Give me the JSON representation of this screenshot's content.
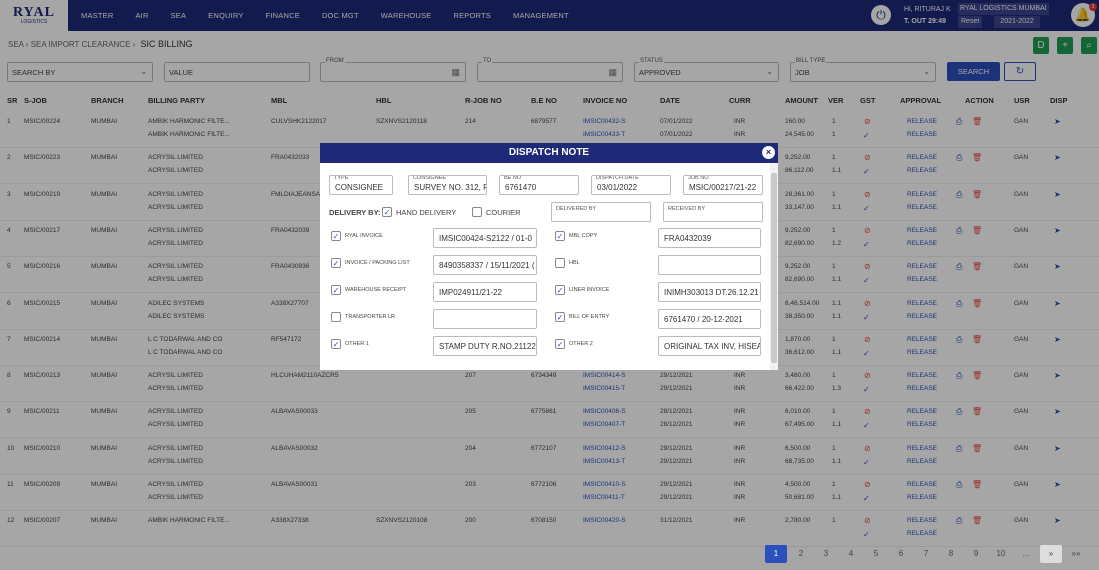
{
  "app": {
    "logo": "RYAL",
    "logo_sub": "LOGISTICS",
    "menu": [
      "MASTER",
      "AIR",
      "SEA",
      "ENQUIRY",
      "FINANCE",
      "DOC MGT",
      "WAREHOUSE",
      "REPORTS",
      "MANAGEMENT"
    ],
    "user_greeting": "Hi, RITURAJ K",
    "user_time": "T. OUT 29:49",
    "company": "RYAL LOGISTICS MUMBAI",
    "reset": "Reset",
    "year": "2021-2022",
    "notif_count": "3"
  },
  "breadcrumb": {
    "a": "SEA",
    "b": "SEA IMPORT CLEARANCE",
    "current": "SIC BILLING"
  },
  "actions": {
    "d": "D",
    "plus": "+",
    "search": "⌕"
  },
  "filters": {
    "search_by": "SEARCH BY",
    "value": "VALUE",
    "from_label": "FROM",
    "to_label": "TO",
    "status_label": "STATUS",
    "status_value": "APPROVED",
    "billtype_label": "BILL TYPE",
    "billtype_value": "JOB",
    "search_btn": "SEARCH",
    "refresh": "↻"
  },
  "table": {
    "headers": [
      "SR",
      "S-JOB",
      "BRANCH",
      "BILLING PARTY",
      "MBL",
      "HBL",
      "R-JOB NO",
      "B.E NO",
      "INVOICE NO",
      "DATE",
      "CURR",
      "AMOUNT",
      "VER",
      "GST",
      "APPROVAL",
      "ACTION",
      "USR",
      "DISP"
    ],
    "rows": [
      {
        "sr": "1",
        "job": "MSIC/00224",
        "branch": "MUMBAI",
        "party1": "AMBIK HARMONIC FILTE...",
        "party2": "AMBIK HARMONIC FILTE...",
        "mbl": "CULVSHK2122017",
        "hbl": "SZXNVS2120118",
        "rjob": "214",
        "be": "6879577",
        "inv1": "IMSIC00432-S",
        "inv2": "IMSIC00433-T",
        "d1": "07/01/2022",
        "d2": "07/01/2022",
        "c1": "INR",
        "c2": "INR",
        "a1": "260.00",
        "a2": "24,545.00",
        "v1": "1",
        "v2": "1",
        "app": "RELEASE",
        "usr": "GAN"
      },
      {
        "sr": "2",
        "job": "MSIC/00223",
        "branch": "MUMBAI",
        "party1": "ACRYSIL LIMITED",
        "party2": "ACRYSIL LIMITED",
        "mbl": "FRA0432033",
        "hbl": "",
        "rjob": "",
        "be": "",
        "inv1": "",
        "inv2": "",
        "d1": "",
        "d2": "",
        "c1": "",
        "c2": "",
        "a1": "9,252.00",
        "a2": "86,112.00",
        "v1": "1",
        "v2": "1.1",
        "app": "RELEASE",
        "usr": "GAN"
      },
      {
        "sr": "3",
        "job": "MSIC/00219",
        "branch": "MUMBAI",
        "party1": "ACRYSIL LIMITED",
        "party2": "ACRYSIL LIMITED",
        "mbl": "FMLDIAJEANSA0",
        "hbl": "",
        "rjob": "",
        "be": "",
        "inv1": "",
        "inv2": "",
        "d1": "",
        "d2": "",
        "c1": "",
        "c2": "",
        "a1": "28,361.00",
        "a2": "33,147.00",
        "v1": "1",
        "v2": "1.1",
        "app": "RELEASE",
        "usr": "GAN"
      },
      {
        "sr": "4",
        "job": "MSIC/00217",
        "branch": "MUMBAI",
        "party1": "ACRYSIL LIMITED",
        "party2": "ACRYSIL LIMITED",
        "mbl": "FRA0432039",
        "hbl": "",
        "rjob": "",
        "be": "",
        "inv1": "",
        "inv2": "",
        "d1": "",
        "d2": "",
        "c1": "",
        "c2": "",
        "a1": "9,252.00",
        "a2": "82,690.00",
        "v1": "1",
        "v2": "1.2",
        "app": "RELEASE",
        "usr": "GAN"
      },
      {
        "sr": "5",
        "job": "MSIC/00216",
        "branch": "MUMBAI",
        "party1": "ACRYSIL LIMITED",
        "party2": "ACRYSIL LIMITED",
        "mbl": "FRA0430936",
        "hbl": "",
        "rjob": "",
        "be": "",
        "inv1": "",
        "inv2": "",
        "d1": "",
        "d2": "",
        "c1": "",
        "c2": "",
        "a1": "9,252.00",
        "a2": "82,690.00",
        "v1": "1",
        "v2": "1.1",
        "app": "RELEASE",
        "usr": "GAN"
      },
      {
        "sr": "6",
        "job": "MSIC/00215",
        "branch": "MUMBAI",
        "party1": "ADILEC SYSTEMS",
        "party2": "ADILEC SYSTEMS",
        "mbl": "A338X27707",
        "hbl": "",
        "rjob": "",
        "be": "",
        "inv1": "",
        "inv2": "",
        "d1": "",
        "d2": "",
        "c1": "",
        "c2": "",
        "a1": "6,46,514.00",
        "a2": "38,350.00",
        "v1": "1.1",
        "v2": "1.1",
        "app": "RELEASE",
        "usr": "GAN"
      },
      {
        "sr": "7",
        "job": "MSIC/00214",
        "branch": "MUMBAI",
        "party1": "L C TODARWAL AND CO",
        "party2": "L C TODARWAL AND CO",
        "mbl": "RF547172",
        "hbl": "",
        "rjob": "",
        "be": "",
        "inv1": "",
        "inv2": "",
        "d1": "",
        "d2": "",
        "c1": "",
        "c2": "",
        "a1": "1,870.00",
        "a2": "36,612.00",
        "v1": "1",
        "v2": "1.1",
        "app": "RELEASE",
        "usr": "GAN"
      },
      {
        "sr": "8",
        "job": "MSIC/00213",
        "branch": "MUMBAI",
        "party1": "ACRYSIL LIMITED",
        "party2": "ACRYSIL LIMITED",
        "mbl": "HLCUHAM2110AZCR5",
        "hbl": "",
        "rjob": "207",
        "be": "6734349",
        "inv1": "IMSIC00414-S",
        "inv2": "IMSIC00415-T",
        "d1": "29/12/2021",
        "d2": "29/12/2021",
        "c1": "INR",
        "c2": "INR",
        "a1": "3,480.00",
        "a2": "66,422.00",
        "v1": "1",
        "v2": "1.3",
        "app": "RELEASE",
        "usr": "GAN"
      },
      {
        "sr": "9",
        "job": "MSIC/00211",
        "branch": "MUMBAI",
        "party1": "ACRYSIL LIMITED",
        "party2": "ACRYSIL LIMITED",
        "mbl": "ALBAVAS00033",
        "hbl": "",
        "rjob": "205",
        "be": "6775861",
        "inv1": "IMSIC00406-S",
        "inv2": "IMSIC00407-T",
        "d1": "28/12/2021",
        "d2": "28/12/2021",
        "c1": "INR",
        "c2": "INR",
        "a1": "6,010.00",
        "a2": "67,495.00",
        "v1": "1",
        "v2": "1.1",
        "app": "RELEASE",
        "usr": "GAN"
      },
      {
        "sr": "10",
        "job": "MSIC/00210",
        "branch": "MUMBAI",
        "party1": "ACRYSIL LIMITED",
        "party2": "ACRYSIL LIMITED",
        "mbl": "ALBAVAS00032",
        "hbl": "",
        "rjob": "204",
        "be": "6772107",
        "inv1": "IMSIC00412-S",
        "inv2": "IMSIC00413-T",
        "d1": "29/12/2021",
        "d2": "29/12/2021",
        "c1": "INR",
        "c2": "INR",
        "a1": "6,500.00",
        "a2": "68,735.00",
        "v1": "1",
        "v2": "1.1",
        "app": "RELEASE",
        "usr": "GAN"
      },
      {
        "sr": "11",
        "job": "MSIC/00209",
        "branch": "MUMBAI",
        "party1": "ACRYSIL LIMITED",
        "party2": "ACRYSIL LIMITED",
        "mbl": "ALBAVAS00031",
        "hbl": "",
        "rjob": "203",
        "be": "6772106",
        "inv1": "IMSIC00410-S",
        "inv2": "IMSIC00411-T",
        "d1": "29/12/2021",
        "d2": "29/12/2021",
        "c1": "INR",
        "c2": "INR",
        "a1": "4,500.00",
        "a2": "50,681.00",
        "v1": "1",
        "v2": "1.1",
        "app": "RELEASE",
        "usr": "GAN"
      },
      {
        "sr": "12",
        "job": "MSIC/00207",
        "branch": "MUMBAI",
        "party1": "AMBIK HARMONIC FILTE...",
        "party2": "",
        "mbl": "A338X27338",
        "hbl": "SZXNVS2120108",
        "rjob": "200",
        "be": "6708150",
        "inv1": "IMSIC00420-S",
        "inv2": "",
        "d1": "31/12/2021",
        "d2": "",
        "c1": "INR",
        "c2": "",
        "a1": "2,780.00",
        "a2": "",
        "v1": "1",
        "v2": "",
        "app": "RELEASE",
        "usr": "GAN"
      }
    ]
  },
  "modal": {
    "title": "DISPATCH NOTE",
    "close": "×",
    "type_label": "TYPE",
    "type_value": "CONSIGNEE",
    "consignee_label": "CONSIGNEE",
    "consignee_value": "SURVEY NO. 312, FLO",
    "be_label": "BE NO",
    "be_value": "6761470",
    "date_label": "DISPATCH DATE",
    "date_value": "03/01/2022",
    "job_label": "JOB NO",
    "job_value": "MSIC/00217/21-22",
    "delivery_by": "DELIVERY BY:",
    "hand": "HAND DELIVERY",
    "courier": "COURIER",
    "delivered_by": "DELIVERED BY",
    "received_by": "RECEIVED BY",
    "docs": [
      {
        "label": "RYAL INVOICE",
        "value": "IMSIC00424-S2122 / 01-0",
        "checked": true
      },
      {
        "label": "MBL COPY",
        "value": "FRA0432039",
        "checked": true
      },
      {
        "label": "INVOICE / PACKING LIST",
        "value": "8490358337 / 15/11/2021 (",
        "checked": true
      },
      {
        "label": "HBL",
        "value": "",
        "checked": false
      },
      {
        "label": "WAREHOUSE RECEIPT",
        "value": "IMP024911/21-22",
        "checked": true
      },
      {
        "label": "LINER INVOICE",
        "value": "INIMH303013 DT.26.12.21",
        "checked": true
      },
      {
        "label": "TRANSPORTER LR",
        "value": "",
        "checked": false
      },
      {
        "label": "BILL OF ENTRY",
        "value": "6761470 / 20-12-2021",
        "checked": true
      },
      {
        "label": "OTHER 1",
        "value": "STAMP DUTY R.NO.2112291",
        "checked": true
      },
      {
        "label": "OTHER 2",
        "value": "ORIGINAL TAX INV, HISEAS",
        "checked": true
      }
    ]
  },
  "pager": [
    "1",
    "2",
    "3",
    "4",
    "5",
    "6",
    "7",
    "8",
    "9",
    "10",
    "...",
    "»",
    "»»"
  ]
}
